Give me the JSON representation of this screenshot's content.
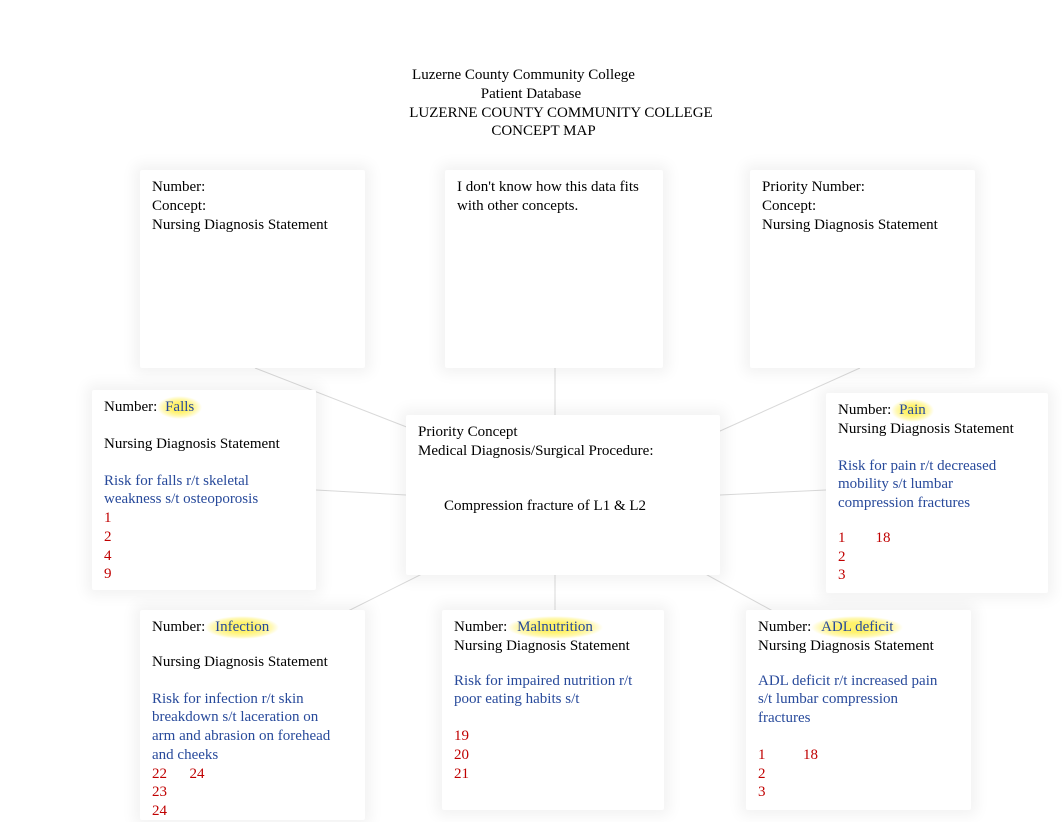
{
  "header": {
    "line1": "Luzerne County Community College",
    "line2": "Patient Database",
    "line3": "LUZERNE COUNTY COMMUNITY COLLEGE",
    "line4": "CONCEPT MAP"
  },
  "boxes": {
    "top_left": {
      "l1": "Number:",
      "l2": "Concept:",
      "l3": "Nursing Diagnosis Statement"
    },
    "top_mid": {
      "l1": "I don't know how this data fits",
      "l2": "with other concepts."
    },
    "top_right": {
      "l1": "Priority Number:",
      "l2": "Concept:",
      "l3": "Nursing Diagnosis Statement"
    },
    "falls": {
      "num_label": "Number:",
      "concept": "Falls",
      "nds": "Nursing Diagnosis Statement",
      "stmt1": " Risk for falls r/t skeletal",
      "stmt2": "weakness s/t osteoporosis",
      "n1": "1",
      "n2": "2",
      "n3": "4",
      "n4": "9"
    },
    "center": {
      "l1": "Priority Concept",
      "l2": "Medical Diagnosis/Surgical Procedure:",
      "diag": "Compression fracture of L1 & L2"
    },
    "pain": {
      "num_label": "Number:",
      "concept": "Pain",
      "nds": "Nursing Diagnosis Statement",
      "stmt1": " Risk for pain r/t decreased",
      "stmt2": "mobility s/t lumbar",
      "stmt3": "compression fractures",
      "n1": "1        18",
      "n2": "2",
      "n3": "3"
    },
    "infection": {
      "num_label": "Number:",
      "concept": "Infection",
      "nds": "Nursing Diagnosis Statement",
      "stmt1": "Risk for infection r/t skin",
      "stmt2": "breakdown s/t laceration on",
      "stmt3": "arm and abrasion on forehead",
      "stmt4": "and cheeks",
      "n1": "22      24",
      "n2": "23",
      "n3": "24"
    },
    "malnut": {
      "num_label": "Number:",
      "concept": "Malnutrition",
      "nds": "Nursing Diagnosis Statement",
      "stmt1": "Risk for impaired nutrition r/t",
      "stmt2": "poor eating habits s/t",
      "n1": "19",
      "n2": "20",
      "n3": "21"
    },
    "adl": {
      "num_label": "Number:",
      "concept": "ADL deficit",
      "nds": "Nursing Diagnosis Statement",
      "stmt1": "ADL deficit r/t increased pain",
      "stmt2": "s/t lumbar compression",
      "stmt3": "fractures",
      "n1": "1          18",
      "n2": "2",
      "n3": "3"
    }
  }
}
